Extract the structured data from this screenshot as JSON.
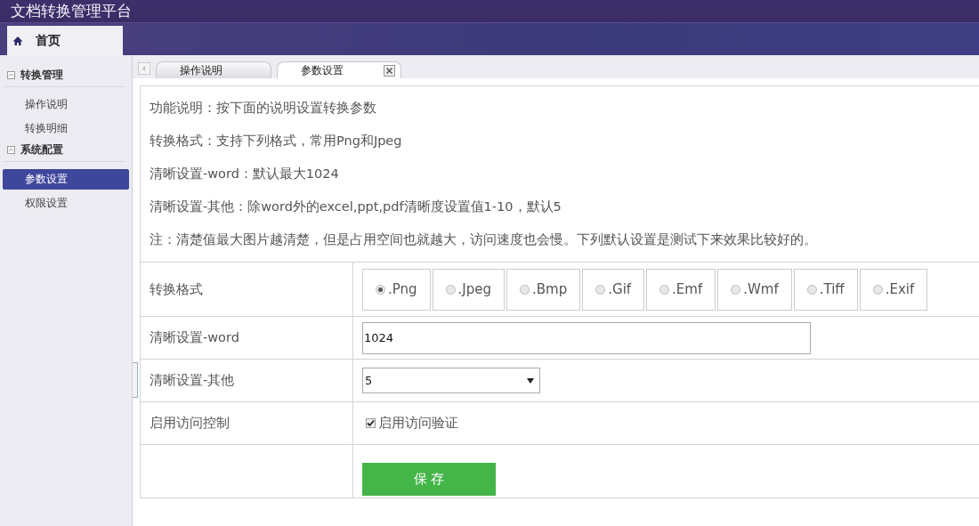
{
  "app_title": "文档转换管理平台",
  "home_tab": {
    "label": "首页",
    "selected": true
  },
  "sidebar": {
    "groups": [
      {
        "label": "转换管理",
        "expanded": true,
        "items": [
          {
            "label": "操作说明",
            "selected": false
          },
          {
            "label": "转换明细",
            "selected": false
          }
        ]
      },
      {
        "label": "系统配置",
        "expanded": true,
        "items": [
          {
            "label": "参数设置",
            "selected": true
          },
          {
            "label": "权限设置",
            "selected": false
          }
        ]
      }
    ]
  },
  "tabs": [
    {
      "label": "操作说明",
      "selected": false,
      "closable": false
    },
    {
      "label": "参数设置",
      "selected": true,
      "closable": true
    }
  ],
  "notes": [
    "功能说明：按下面的说明设置转换参数",
    "转换格式：支持下列格式，常用Png和Jpeg",
    "清晰设置-word：默认最大1024",
    "清晰设置-其他：除word外的excel,ppt,pdf清晰度设置值1-10，默认5",
    "注：清楚值最大图片越清楚，但是占用空间也就越大，访问速度也会慢。下列默认设置是测试下来效果比较好的。"
  ],
  "form": [
    {
      "kind": "radio",
      "label": "转换格式",
      "options": [
        {
          "label": ".Png",
          "selected": true
        },
        {
          "label": ".Jpeg",
          "selected": false
        },
        {
          "label": ".Bmp",
          "selected": false
        },
        {
          "label": ".Gif",
          "selected": false
        },
        {
          "label": ".Emf",
          "selected": false
        },
        {
          "label": ".Wmf",
          "selected": false
        },
        {
          "label": ".Tiff",
          "selected": false
        },
        {
          "label": ".Exif",
          "selected": false
        }
      ]
    },
    {
      "kind": "text",
      "label": "清晰设置-word",
      "value": "1024"
    },
    {
      "kind": "select",
      "label": "清晰设置-其他",
      "value": "5"
    },
    {
      "kind": "checkbox",
      "label": "启用访问控制",
      "option": "启用访问验证",
      "checked": true
    },
    {
      "kind": "button",
      "button": "保 存"
    }
  ]
}
